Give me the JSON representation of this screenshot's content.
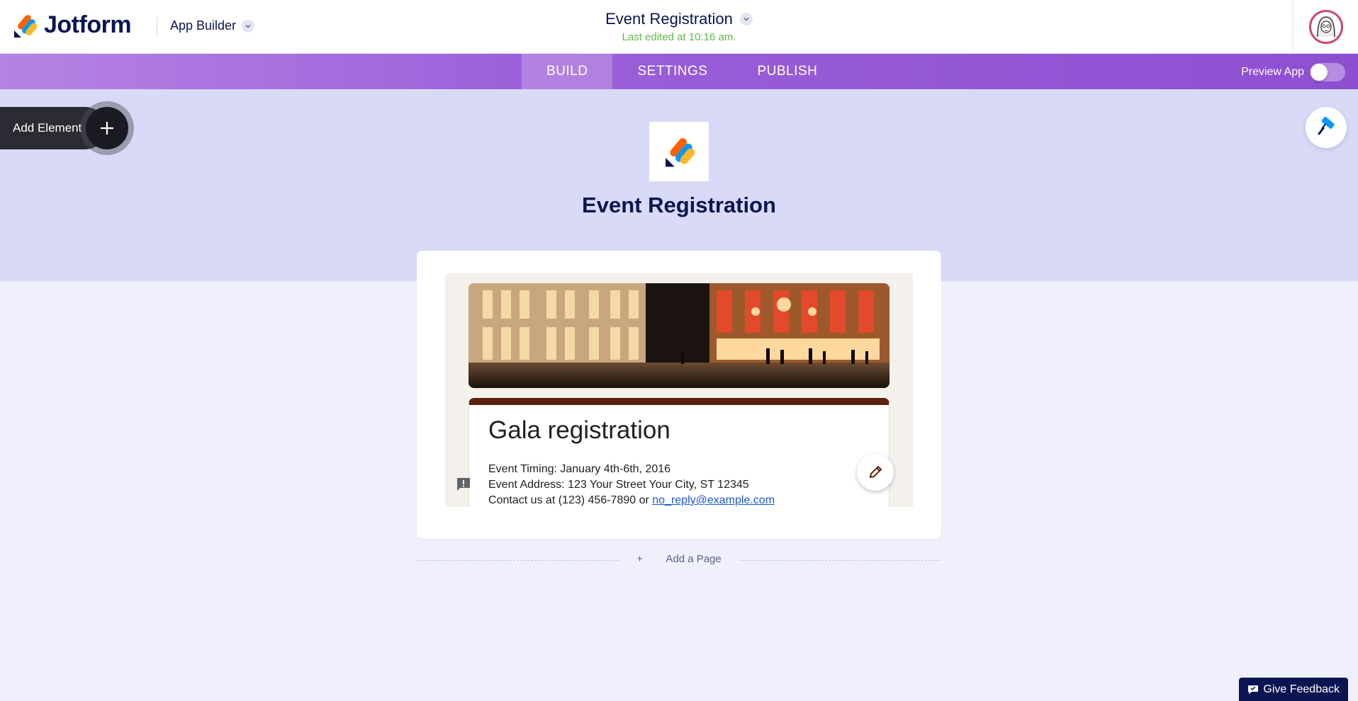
{
  "header": {
    "brand": "Jotform",
    "product_label": "App Builder",
    "app_title": "Event Registration",
    "last_edited": "Last edited at 10:16 am."
  },
  "nav": {
    "tabs": [
      {
        "label": "BUILD",
        "active": true
      },
      {
        "label": "SETTINGS",
        "active": false
      },
      {
        "label": "PUBLISH",
        "active": false
      }
    ],
    "preview_label": "Preview App",
    "preview_on": false
  },
  "builder": {
    "add_element_label": "Add Element",
    "app_name": "Event Registration",
    "add_page_label": "Add a Page"
  },
  "form_preview": {
    "title": "Gala registration",
    "timing": "Event Timing: January 4th-6th, 2016",
    "address": "Event Address: 123 Your Street Your City, ST 12345",
    "contact_prefix": "Contact us at (123) 456-7890 or ",
    "contact_email": "no_reply@example.com"
  },
  "footer": {
    "feedback_label": "Give Feedback"
  },
  "icons": {
    "logo": "jotform-logo-icon",
    "avatar": "user-avatar",
    "add": "plus-icon",
    "designer": "paint-roller-icon",
    "edit": "pencil-icon",
    "comment": "comment-alert-icon",
    "feedback": "chat-icon"
  },
  "colors": {
    "nav_gradient_start": "#b583e4",
    "nav_gradient_end": "#8e4fd2",
    "band": "#d9daf8",
    "page_bg": "#eff0fc",
    "brand_navy": "#0a1551",
    "last_edited_green": "#5fb84a",
    "form_accent": "#5b2410"
  }
}
